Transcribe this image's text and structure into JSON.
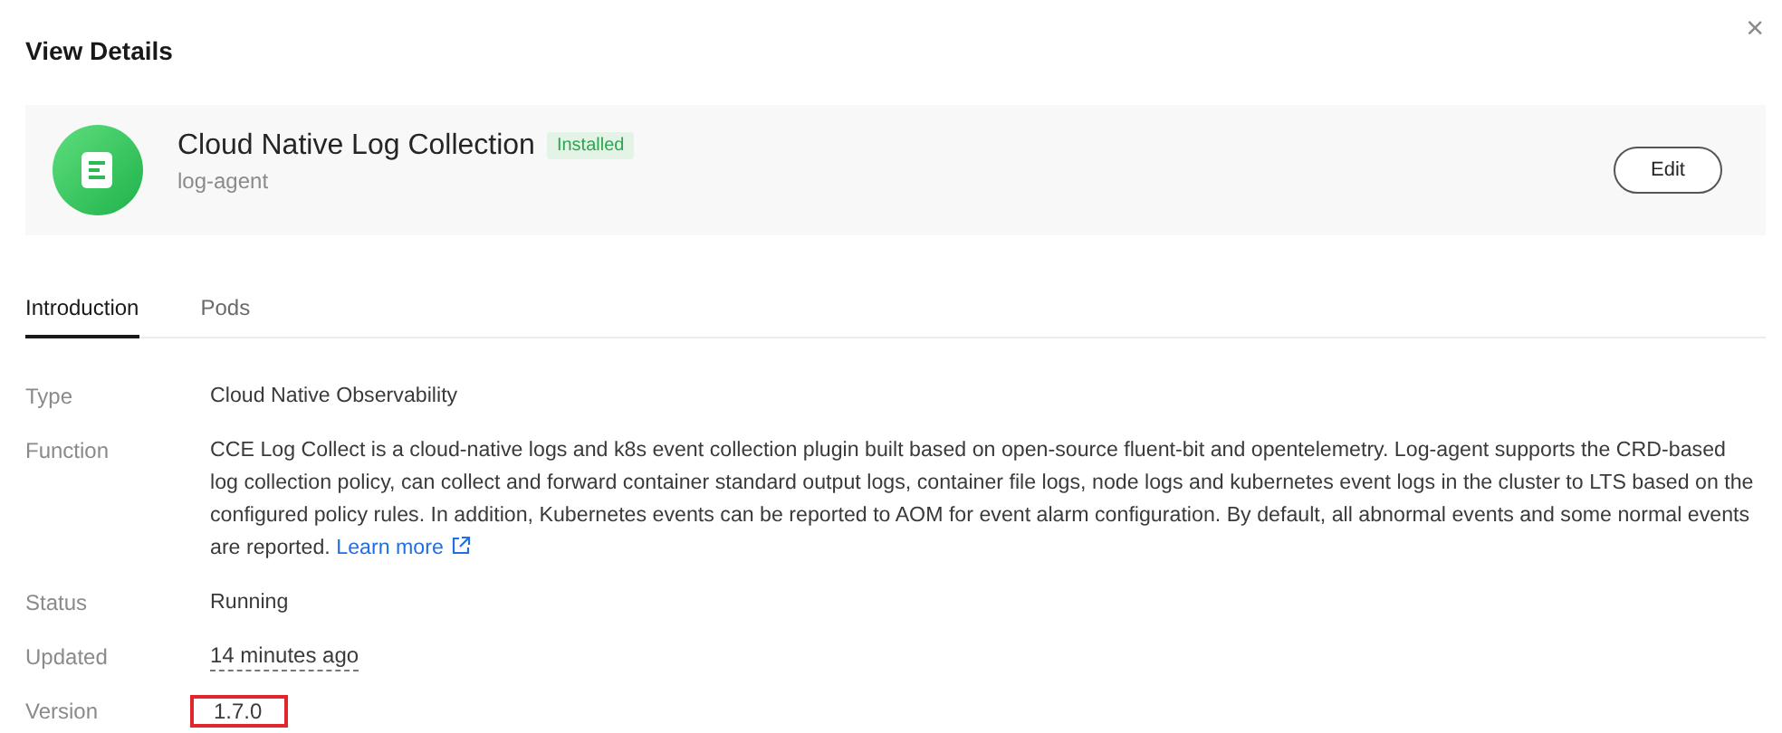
{
  "dialog": {
    "title": "View Details",
    "close_label": "×"
  },
  "plugin": {
    "name": "Cloud Native Log Collection",
    "badge": "Installed",
    "id": "log-agent",
    "edit_button": "Edit"
  },
  "tabs": [
    {
      "label": "Introduction",
      "selected": true
    },
    {
      "label": "Pods",
      "selected": false
    }
  ],
  "details": [
    {
      "kind": "text",
      "label": "Type",
      "value": "Cloud Native Observability"
    },
    {
      "kind": "paragraph",
      "label": "Function",
      "value": "CCE Log Collect is a cloud-native logs and k8s event collection plugin built based on open-source fluent-bit and opentelemetry. Log-agent supports the CRD-based log collection policy, can collect and forward container standard output logs, container file logs, node logs and kubernetes event logs in the cluster to LTS based on the configured policy rules. In addition, Kubernetes events can be reported to AOM for event alarm configuration. By default, all abnormal events and some normal events are reported.",
      "link": "Learn more"
    },
    {
      "kind": "text",
      "label": "Status",
      "value": "Running"
    },
    {
      "kind": "time",
      "label": "Updated",
      "value": "14 minutes ago"
    },
    {
      "kind": "text",
      "label": "Version",
      "value": "1.7.0",
      "highlighted": true
    }
  ]
}
